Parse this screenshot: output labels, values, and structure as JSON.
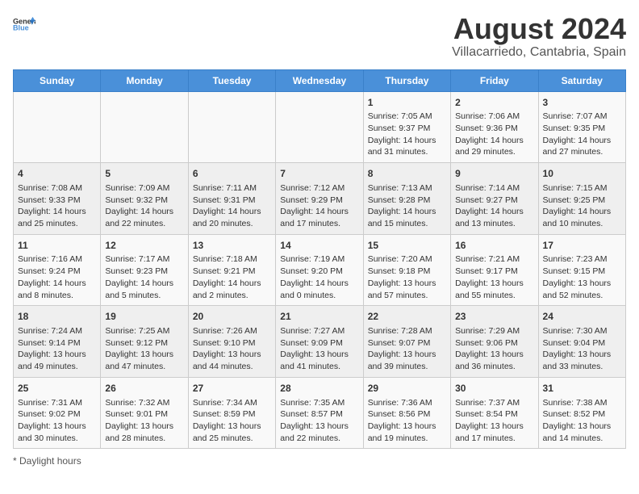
{
  "header": {
    "logo_general": "General",
    "logo_blue": "Blue",
    "title": "August 2024",
    "subtitle": "Villacarriedo, Cantabria, Spain"
  },
  "weekdays": [
    "Sunday",
    "Monday",
    "Tuesday",
    "Wednesday",
    "Thursday",
    "Friday",
    "Saturday"
  ],
  "weeks": [
    [
      {
        "day": "",
        "info": ""
      },
      {
        "day": "",
        "info": ""
      },
      {
        "day": "",
        "info": ""
      },
      {
        "day": "",
        "info": ""
      },
      {
        "day": "1",
        "info": "Sunrise: 7:05 AM\nSunset: 9:37 PM\nDaylight: 14 hours and 31 minutes."
      },
      {
        "day": "2",
        "info": "Sunrise: 7:06 AM\nSunset: 9:36 PM\nDaylight: 14 hours and 29 minutes."
      },
      {
        "day": "3",
        "info": "Sunrise: 7:07 AM\nSunset: 9:35 PM\nDaylight: 14 hours and 27 minutes."
      }
    ],
    [
      {
        "day": "4",
        "info": "Sunrise: 7:08 AM\nSunset: 9:33 PM\nDaylight: 14 hours and 25 minutes."
      },
      {
        "day": "5",
        "info": "Sunrise: 7:09 AM\nSunset: 9:32 PM\nDaylight: 14 hours and 22 minutes."
      },
      {
        "day": "6",
        "info": "Sunrise: 7:11 AM\nSunset: 9:31 PM\nDaylight: 14 hours and 20 minutes."
      },
      {
        "day": "7",
        "info": "Sunrise: 7:12 AM\nSunset: 9:29 PM\nDaylight: 14 hours and 17 minutes."
      },
      {
        "day": "8",
        "info": "Sunrise: 7:13 AM\nSunset: 9:28 PM\nDaylight: 14 hours and 15 minutes."
      },
      {
        "day": "9",
        "info": "Sunrise: 7:14 AM\nSunset: 9:27 PM\nDaylight: 14 hours and 13 minutes."
      },
      {
        "day": "10",
        "info": "Sunrise: 7:15 AM\nSunset: 9:25 PM\nDaylight: 14 hours and 10 minutes."
      }
    ],
    [
      {
        "day": "11",
        "info": "Sunrise: 7:16 AM\nSunset: 9:24 PM\nDaylight: 14 hours and 8 minutes."
      },
      {
        "day": "12",
        "info": "Sunrise: 7:17 AM\nSunset: 9:23 PM\nDaylight: 14 hours and 5 minutes."
      },
      {
        "day": "13",
        "info": "Sunrise: 7:18 AM\nSunset: 9:21 PM\nDaylight: 14 hours and 2 minutes."
      },
      {
        "day": "14",
        "info": "Sunrise: 7:19 AM\nSunset: 9:20 PM\nDaylight: 14 hours and 0 minutes."
      },
      {
        "day": "15",
        "info": "Sunrise: 7:20 AM\nSunset: 9:18 PM\nDaylight: 13 hours and 57 minutes."
      },
      {
        "day": "16",
        "info": "Sunrise: 7:21 AM\nSunset: 9:17 PM\nDaylight: 13 hours and 55 minutes."
      },
      {
        "day": "17",
        "info": "Sunrise: 7:23 AM\nSunset: 9:15 PM\nDaylight: 13 hours and 52 minutes."
      }
    ],
    [
      {
        "day": "18",
        "info": "Sunrise: 7:24 AM\nSunset: 9:14 PM\nDaylight: 13 hours and 49 minutes."
      },
      {
        "day": "19",
        "info": "Sunrise: 7:25 AM\nSunset: 9:12 PM\nDaylight: 13 hours and 47 minutes."
      },
      {
        "day": "20",
        "info": "Sunrise: 7:26 AM\nSunset: 9:10 PM\nDaylight: 13 hours and 44 minutes."
      },
      {
        "day": "21",
        "info": "Sunrise: 7:27 AM\nSunset: 9:09 PM\nDaylight: 13 hours and 41 minutes."
      },
      {
        "day": "22",
        "info": "Sunrise: 7:28 AM\nSunset: 9:07 PM\nDaylight: 13 hours and 39 minutes."
      },
      {
        "day": "23",
        "info": "Sunrise: 7:29 AM\nSunset: 9:06 PM\nDaylight: 13 hours and 36 minutes."
      },
      {
        "day": "24",
        "info": "Sunrise: 7:30 AM\nSunset: 9:04 PM\nDaylight: 13 hours and 33 minutes."
      }
    ],
    [
      {
        "day": "25",
        "info": "Sunrise: 7:31 AM\nSunset: 9:02 PM\nDaylight: 13 hours and 30 minutes."
      },
      {
        "day": "26",
        "info": "Sunrise: 7:32 AM\nSunset: 9:01 PM\nDaylight: 13 hours and 28 minutes."
      },
      {
        "day": "27",
        "info": "Sunrise: 7:34 AM\nSunset: 8:59 PM\nDaylight: 13 hours and 25 minutes."
      },
      {
        "day": "28",
        "info": "Sunrise: 7:35 AM\nSunset: 8:57 PM\nDaylight: 13 hours and 22 minutes."
      },
      {
        "day": "29",
        "info": "Sunrise: 7:36 AM\nSunset: 8:56 PM\nDaylight: 13 hours and 19 minutes."
      },
      {
        "day": "30",
        "info": "Sunrise: 7:37 AM\nSunset: 8:54 PM\nDaylight: 13 hours and 17 minutes."
      },
      {
        "day": "31",
        "info": "Sunrise: 7:38 AM\nSunset: 8:52 PM\nDaylight: 13 hours and 14 minutes."
      }
    ]
  ],
  "footer": {
    "note": "Daylight hours"
  },
  "colors": {
    "header_bg": "#4a90d9",
    "header_text": "#ffffff",
    "accent_blue": "#4a90d9"
  }
}
